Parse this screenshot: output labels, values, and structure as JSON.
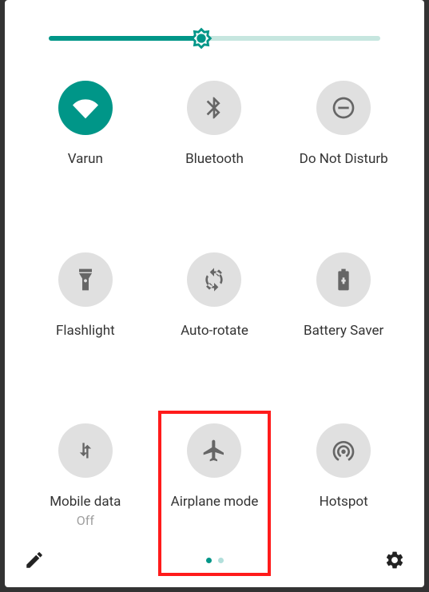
{
  "brightness": {
    "percent": 46
  },
  "tiles": [
    {
      "label": "Varun",
      "sub": "",
      "icon": "wifi",
      "active": true,
      "highlight": false
    },
    {
      "label": "Bluetooth",
      "sub": "",
      "icon": "bluetooth",
      "active": false,
      "highlight": false
    },
    {
      "label": "Do Not Disturb",
      "sub": "",
      "icon": "dnd",
      "active": false,
      "highlight": false
    },
    {
      "label": "Flashlight",
      "sub": "",
      "icon": "flashlight",
      "active": false,
      "highlight": false
    },
    {
      "label": "Auto-rotate",
      "sub": "",
      "icon": "autorotate",
      "active": false,
      "highlight": false
    },
    {
      "label": "Battery Saver",
      "sub": "",
      "icon": "battery",
      "active": false,
      "highlight": false
    },
    {
      "label": "Mobile data",
      "sub": "Off",
      "icon": "mobiledata",
      "active": false,
      "highlight": false
    },
    {
      "label": "Airplane mode",
      "sub": "",
      "icon": "airplane",
      "active": false,
      "highlight": true
    },
    {
      "label": "Hotspot",
      "sub": "",
      "icon": "hotspot",
      "active": false,
      "highlight": false
    }
  ],
  "pages": {
    "count": 2,
    "active": 0
  },
  "colors": {
    "accent": "#009688",
    "tileInactive": "#e0e0e0",
    "highlight": "#ff1b1b"
  }
}
